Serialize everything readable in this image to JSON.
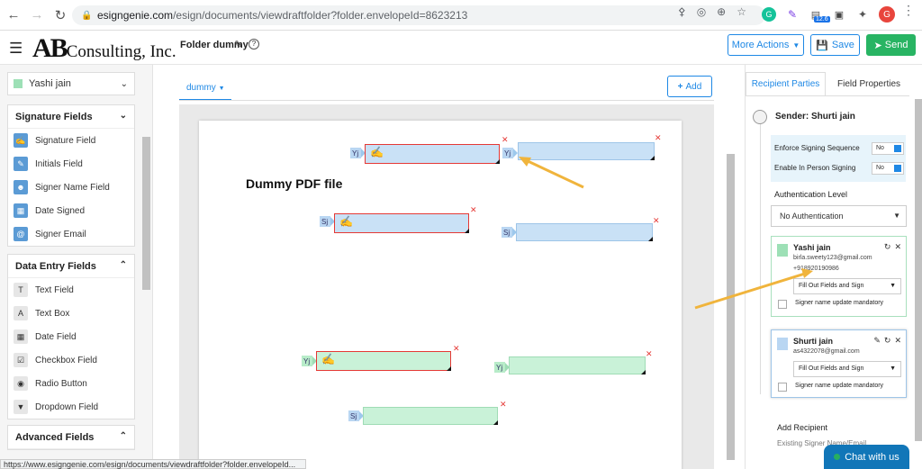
{
  "browser": {
    "url_host": "esigngenie.com",
    "url_path": "/esign/documents/viewdraftfolder?folder.envelopeId=8623213",
    "ext_badge": "12.6",
    "profile_letter": "G",
    "status_url": "https://www.esigngenie.com/esign/documents/viewdraftfolder?folder.envelopeId..."
  },
  "header": {
    "logo_big": "AB",
    "logo_text": "Consulting, Inc.",
    "folder_title": "Folder dummy",
    "more_actions": "More Actions",
    "save": "Save",
    "send": "Send"
  },
  "sidebar": {
    "selected_signer": "Yashi jain",
    "signature_fields": {
      "title": "Signature Fields",
      "items": [
        {
          "label": "Signature Field",
          "icon": "signature-icon"
        },
        {
          "label": "Initials Field",
          "icon": "pen-icon"
        },
        {
          "label": "Signer Name Field",
          "icon": "user-icon"
        },
        {
          "label": "Date Signed",
          "icon": "calendar-icon"
        },
        {
          "label": "Signer Email",
          "icon": "at-icon"
        }
      ]
    },
    "data_entry_fields": {
      "title": "Data Entry Fields",
      "items": [
        {
          "label": "Text Field",
          "icon": "text-field-icon"
        },
        {
          "label": "Text Box",
          "icon": "text-box-icon"
        },
        {
          "label": "Date Field",
          "icon": "calendar-icon"
        },
        {
          "label": "Checkbox Field",
          "icon": "checkbox-icon"
        },
        {
          "label": "Radio Button",
          "icon": "radio-icon"
        },
        {
          "label": "Dropdown Field",
          "icon": "dropdown-icon"
        }
      ]
    },
    "advanced_fields": {
      "title": "Advanced Fields"
    }
  },
  "document": {
    "tab": "dummy",
    "add_button": "Add",
    "heading": "Dummy PDF file",
    "tags": {
      "yashi": "Yj",
      "shurti": "Sj"
    }
  },
  "right_panel": {
    "tab_recipients": "Recipient Parties",
    "tab_field_props": "Field Properties",
    "sender": "Sender: Shurti jain",
    "enforce_label": "Enforce Signing Sequence",
    "enforce_value": "No",
    "in_person_label": "Enable In Person Signing",
    "in_person_value": "No",
    "auth_label": "Authentication Level",
    "auth_value": "No Authentication",
    "recipients": [
      {
        "name": "Yashi jain",
        "email": "birla.sweety123@gmail.com",
        "phone": "+918920190986",
        "action": "Fill Out Fields and Sign",
        "mandatory": "Signer name update mandatory",
        "color": "#9de0b6"
      },
      {
        "name": "Shurti jain",
        "email": "as4322078@gmail.com",
        "action": "Fill Out Fields and Sign",
        "mandatory": "Signer name update mandatory",
        "color": "#b9d6f2"
      }
    ],
    "add_recipient": "Add Recipient",
    "existing_signer": "Existing Signer Name/Email"
  },
  "chat": {
    "label": "Chat with us"
  },
  "colors": {
    "accent": "#1e88e5",
    "send": "#28b463",
    "annotation_arrow": "#f0b43c"
  }
}
